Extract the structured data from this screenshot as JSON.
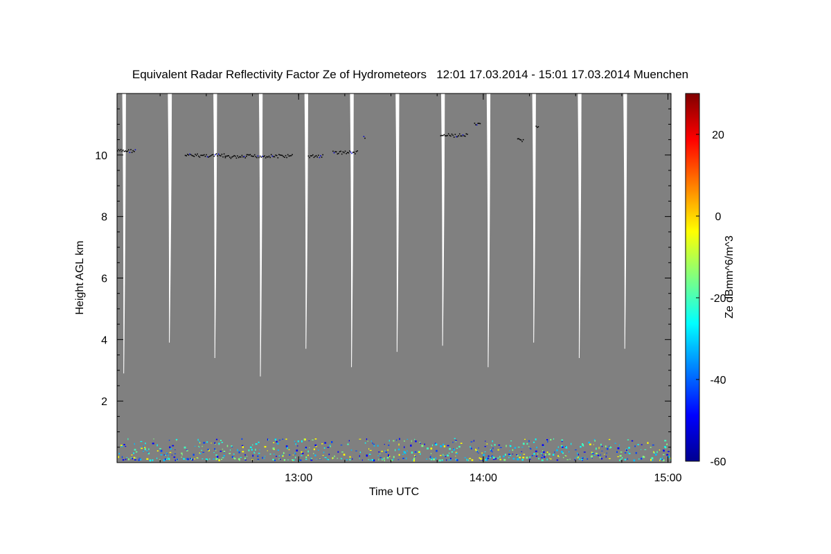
{
  "chart_data": {
    "type": "heatmap",
    "title": "Equivalent Radar Reflectivity Factor Ze of Hydrometeors   12:01 17.03.2014 - 15:01 17.03.2014 Muenchen",
    "xlabel": "Time UTC",
    "ylabel": "Height AGL km",
    "x_range_minutes_utc": [
      721,
      901
    ],
    "xticks": [
      {
        "minute": 780,
        "label": "13:00"
      },
      {
        "minute": 840,
        "label": "14:00"
      },
      {
        "minute": 900,
        "label": "15:00"
      }
    ],
    "ylim": [
      0,
      12
    ],
    "yticks": [
      2,
      4,
      6,
      8,
      10
    ],
    "colorbar": {
      "label": "Ze dBmm^6/m^3",
      "range": [
        -60,
        30
      ],
      "ticks": [
        -60,
        -40,
        -20,
        0,
        20
      ],
      "colormap": "jet"
    },
    "fill_color": "#808080",
    "gap_color": "#ffffff",
    "scan_gaps": [
      {
        "start_min": 722.7,
        "end_min": 723.9,
        "bottom_km": 2.9
      },
      {
        "start_min": 737.5,
        "end_min": 738.8,
        "bottom_km": 3.9
      },
      {
        "start_min": 752.3,
        "end_min": 753.5,
        "bottom_km": 3.4
      },
      {
        "start_min": 767.1,
        "end_min": 768.3,
        "bottom_km": 2.8
      },
      {
        "start_min": 781.9,
        "end_min": 783.1,
        "bottom_km": 3.7
      },
      {
        "start_min": 796.7,
        "end_min": 797.9,
        "bottom_km": 3.1
      },
      {
        "start_min": 811.5,
        "end_min": 812.7,
        "bottom_km": 3.6
      },
      {
        "start_min": 826.3,
        "end_min": 827.5,
        "bottom_km": 3.8
      },
      {
        "start_min": 841.1,
        "end_min": 842.3,
        "bottom_km": 3.1
      },
      {
        "start_min": 855.9,
        "end_min": 857.1,
        "bottom_km": 3.9
      },
      {
        "start_min": 870.7,
        "end_min": 871.9,
        "bottom_km": 3.4
      },
      {
        "start_min": 885.5,
        "end_min": 886.7,
        "bottom_km": 3.7
      }
    ],
    "cirrus_echo_segments": [
      {
        "start_min": 721,
        "end_min": 727,
        "height_km": 10.15
      },
      {
        "start_min": 743,
        "end_min": 756,
        "height_km": 10.0
      },
      {
        "start_min": 756,
        "end_min": 763,
        "height_km": 9.95
      },
      {
        "start_min": 763,
        "end_min": 778,
        "height_km": 9.98
      },
      {
        "start_min": 783,
        "end_min": 788,
        "height_km": 9.98
      },
      {
        "start_min": 791,
        "end_min": 799,
        "height_km": 10.1
      },
      {
        "start_min": 801,
        "end_min": 801.6,
        "height_km": 10.6
      },
      {
        "start_min": 826,
        "end_min": 835,
        "height_km": 10.65
      },
      {
        "start_min": 837,
        "end_min": 839,
        "height_km": 11.0
      },
      {
        "start_min": 851,
        "end_min": 853,
        "height_km": 10.5
      },
      {
        "start_min": 857,
        "end_min": 858,
        "height_km": 10.95
      }
    ],
    "low_level_echo": {
      "height_range_km": [
        0.1,
        0.8
      ],
      "ze_range_dbz": [
        -45,
        -5
      ]
    }
  }
}
